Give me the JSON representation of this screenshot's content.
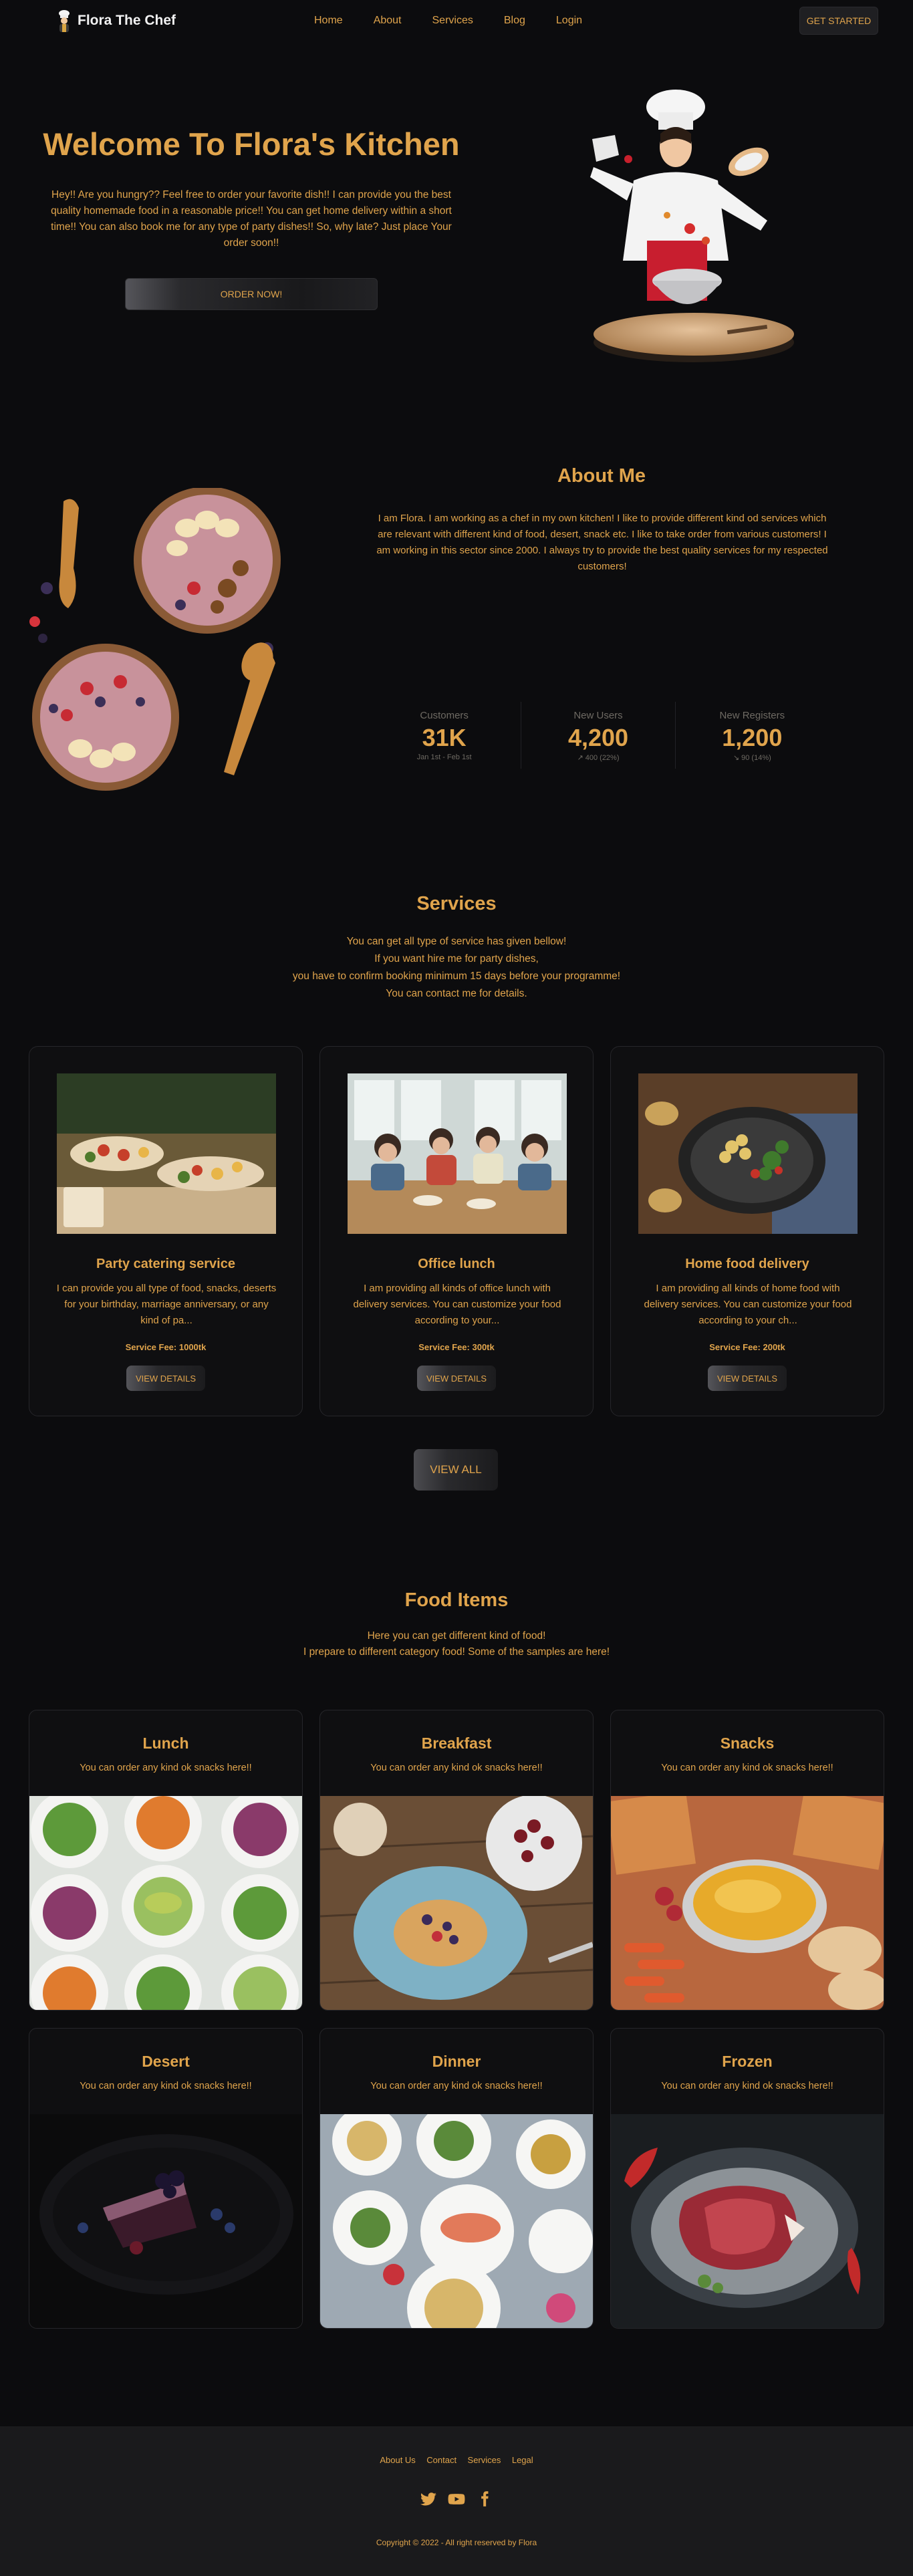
{
  "colors": {
    "accent": "#e0a44c",
    "background": "#0c0c0e",
    "card": "#0f0f11",
    "footer": "#1a1a1c"
  },
  "nav": {
    "brand": "Flora The Chef",
    "items": [
      "Home",
      "About",
      "Services",
      "Blog",
      "Login"
    ],
    "cta": "GET STARTED"
  },
  "hero": {
    "title": "Welcome To Flora's Kitchen",
    "text": "Hey!! Are you hungry?? Feel free to order your favorite dish!! I can provide you the best quality homemade food in a reasonable price!! You can get home delivery within a short time!! You can also book me for any type of party dishes!! So, why late? Just place Your order soon!!",
    "button": "ORDER NOW!"
  },
  "about": {
    "title": "About Me",
    "text": "I am Flora. I am working as a chef in my own kitchen! I like to provide different kind od services which are relevant with different kind of food, desert, snack etc. I like to take order from various customers! I am working in this sector since 2000. I always try to provide the best quality services for my respected customers!",
    "stats": [
      {
        "label": "Customers",
        "value": "31K",
        "desc": "Jan 1st - Feb 1st"
      },
      {
        "label": "New Users",
        "value": "4,200",
        "desc": "↗︎ 400 (22%)"
      },
      {
        "label": "New Registers",
        "value": "1,200",
        "desc": "↘︎ 90 (14%)"
      }
    ]
  },
  "services": {
    "title": "Services",
    "subtitle": [
      "You can get all type of service has given bellow!",
      "If you want hire me for party dishes,",
      "you have to confirm booking minimum 15 days before your programme!",
      "You can contact me for details."
    ],
    "cards": [
      {
        "title": "Party catering service",
        "desc": "I can provide you all type of food, snacks, deserts for your birthday, marriage anniversary, or any kind of pa...",
        "fee": "Service Fee: 1000tk",
        "button": "VIEW DETAILS"
      },
      {
        "title": "Office lunch",
        "desc": "I am providing all kinds of office lunch with delivery services. You can customize your food according to your...",
        "fee": "Service Fee: 300tk",
        "button": "VIEW DETAILS"
      },
      {
        "title": "Home food delivery",
        "desc": "I am providing all kinds of home food with delivery services. You can customize your food according to your ch...",
        "fee": "Service Fee: 200tk",
        "button": "VIEW DETAILS"
      }
    ],
    "view_all": "VIEW ALL"
  },
  "food": {
    "title": "Food Items",
    "subtitle": [
      "Here you can get different kind of food!",
      "I prepare to different category food! Some of the samples are here!"
    ],
    "items": [
      {
        "title": "Lunch",
        "sub": "You can order any kind ok snacks here!!"
      },
      {
        "title": "Breakfast",
        "sub": "You can order any kind ok snacks here!!"
      },
      {
        "title": "Snacks",
        "sub": "You can order any kind ok snacks here!!"
      },
      {
        "title": "Desert",
        "sub": "You can order any kind ok snacks here!!"
      },
      {
        "title": "Dinner",
        "sub": "You can order any kind ok snacks here!!"
      },
      {
        "title": "Frozen",
        "sub": "You can order any kind ok snacks here!!"
      }
    ]
  },
  "footer": {
    "links": [
      "About Us",
      "Contact",
      "Services",
      "Legal"
    ],
    "socials": [
      "twitter-icon",
      "youtube-icon",
      "facebook-icon"
    ],
    "copyright": "Copyright © 2022 - All right reserved by Flora"
  }
}
